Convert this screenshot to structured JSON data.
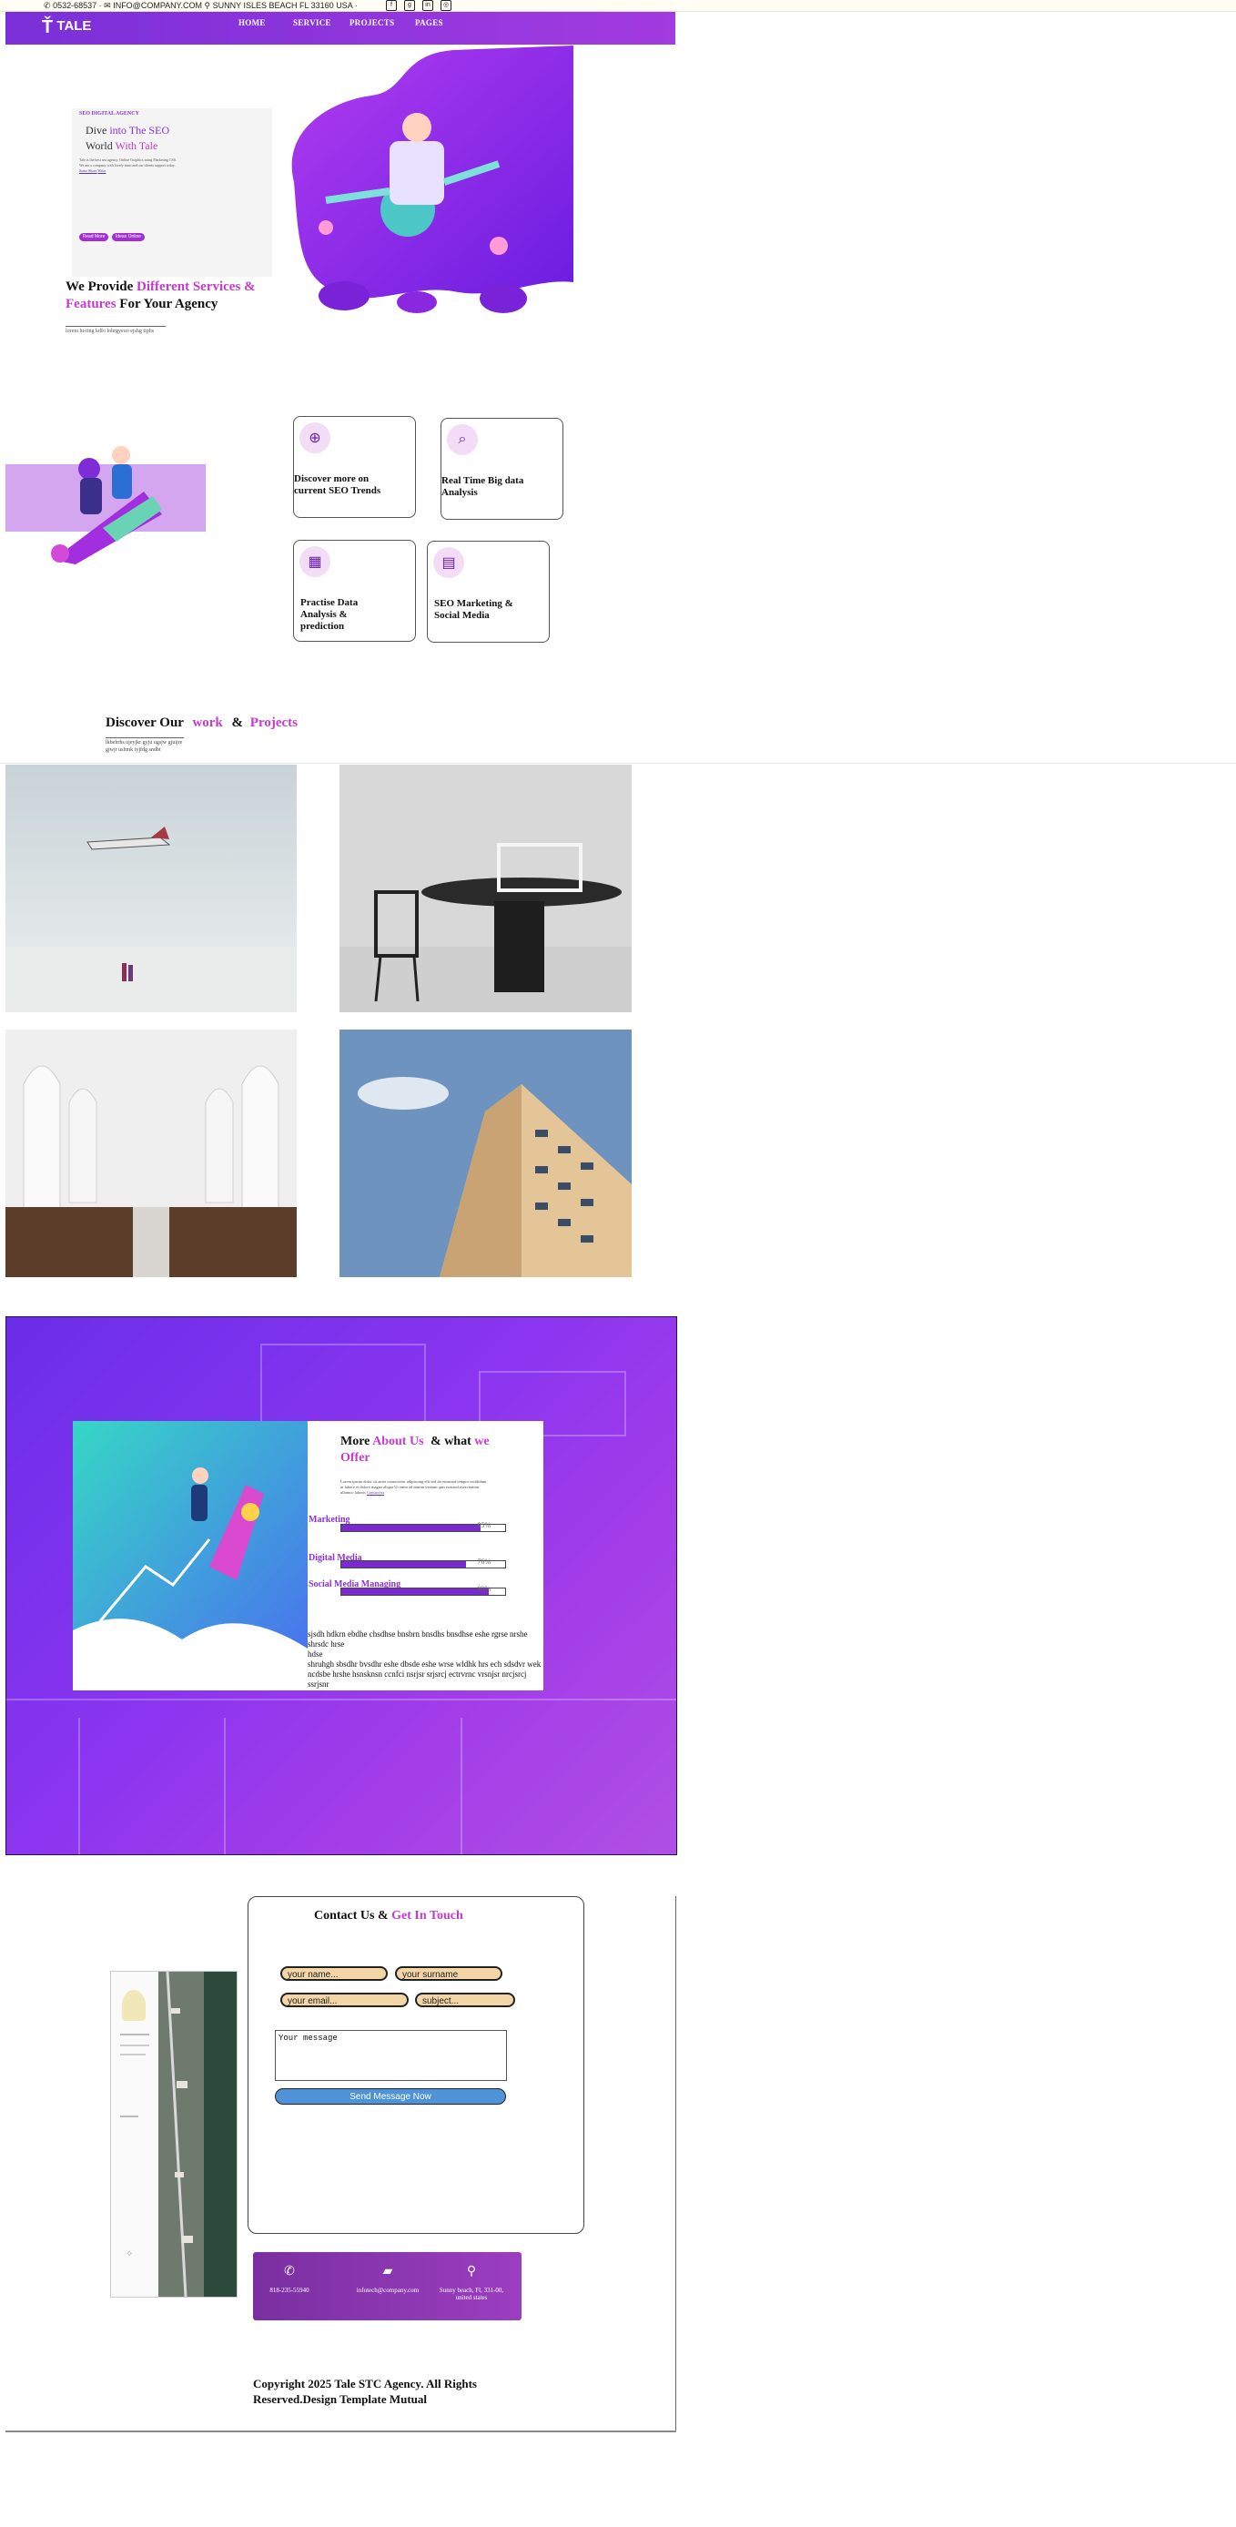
{
  "topbar": {
    "phone": "0532-68537 ·",
    "email": "INFO@COMPANY.COM",
    "address": "SUNNY ISLES BEACH FL 33160 USA ·",
    "socials": [
      "facebook-icon",
      "github-icon",
      "linkedin-icon",
      "instagram-icon"
    ]
  },
  "nav": {
    "logo": "TALE",
    "items": [
      "HOME",
      "SERVICE",
      "PROJECTS",
      "PAGES"
    ]
  },
  "hero": {
    "eyebrow": "SEO DIGITAL AGENCY",
    "line1_a": "Dive",
    "line1_b": "into The SEO",
    "line2_a": "World",
    "line2_b": "With Tale",
    "paragraph": "Tale is the best seo agency. Online Graphics using Marketing CSS. We are a company with lovely team and our clients support today.",
    "link_a": "Some Shore",
    "link_b": "Write",
    "btn1": "Read More",
    "btn2": "Ideas Online"
  },
  "services": {
    "title_a": "We Provide",
    "title_b": "Different Services &",
    "title_c": "Features",
    "title_d": "For Your Agency",
    "note": "lorem ht-ting kdfo lohrgyeuo ejshg tiphs",
    "cards": [
      {
        "icon": "globe-search-icon",
        "title": "Discover more on current SEO Trends"
      },
      {
        "icon": "magnify-chart-icon",
        "title": "Real Time Big data Analysis"
      },
      {
        "icon": "data-analysis-icon",
        "title": "Practise Data Analysis & prediction"
      },
      {
        "icon": "marketing-board-icon",
        "title": "SEO Marketing & Social Media"
      }
    ]
  },
  "work": {
    "title_a": "Discover Our",
    "title_b": "work",
    "title_c": "&",
    "title_d": "Projects",
    "sub": "lkbehrhs ujeyjkr gyju ugsjw gjuijre gjwjr ushmk iyjfdg sndbt"
  },
  "about": {
    "title_a": "More",
    "title_b": "About Us",
    "title_c": "& what",
    "title_d": "we",
    "title_e": "Offer",
    "paragraph": "Lorem ipsum dolor sit amet consectetur adipiscing elit sed do eiusmod tempor incididunt ut labore et dolore magna aliqua Ut enim ad minim veniam quis nostrud exercitation ullamco laboris",
    "link": "Contact us",
    "skills": [
      {
        "label": "Marketing",
        "value": 0.85,
        "pct": "85%"
      },
      {
        "label": "Digital Media",
        "value": 0.76,
        "pct": "76%"
      },
      {
        "label": "Social Media Managing",
        "value": 0.9,
        "pct": "90%"
      }
    ],
    "lines": [
      "sjsdh hdkrn ebdhe chsdhse bnsbrn bnsdhs bnsdhse eshe rgrse nrshe",
      "shrsdc hrse",
      "hdse",
      "shruhgh sbsdhr bvsdhr eshe dbsde eshe wrse wldhk hrs ech sdsdvr wek",
      "ncdsbe hrshe hsnsknsn ccnfci nsrjsr srjsrcj ectrvrnc vrsnjsr nrcjsrcj ssrjsnr"
    ]
  },
  "contact": {
    "title_a": "Contact Us &",
    "title_b": "Get In Touch",
    "name_ph": "your name...",
    "surname_ph": "your surname",
    "email_ph": "your email...",
    "subject_ph": "subject...",
    "message_ph": "Your message",
    "send": "Send Message Now",
    "info": [
      {
        "icon": "phone-icon",
        "text": "818-235-55940"
      },
      {
        "icon": "chat-icon",
        "text": "infotech@company.com"
      },
      {
        "icon": "location-pin-icon",
        "text": "Sunny beach, Fl, 331-00, united states"
      }
    ]
  },
  "footer": {
    "copyright": "Copyright 2025 Tale STC Agency. All Rights Reserved.Design Template Mutual"
  },
  "colors": {
    "accent": "#8c2fe0",
    "pink": "#c73acd",
    "field": "#f3d5a6",
    "send": "#4e92d8"
  }
}
